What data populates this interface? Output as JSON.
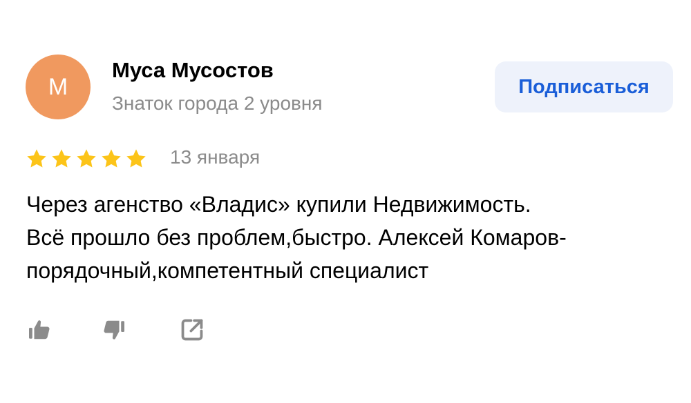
{
  "author": {
    "initial": "М",
    "name": "Муса Мусостов",
    "level": "Знаток города 2 уровня",
    "avatar_color": "#f0995f"
  },
  "subscribe": {
    "label": "Подписаться",
    "color": "#1a5ed8",
    "background": "#eef2fb"
  },
  "review": {
    "rating": 5,
    "rating_max": 5,
    "star_color": "#fcc419",
    "date": "13 января",
    "text_lines": [
      "Через агенство «Владис» купили Недвижимость.",
      "Всё прошло без проблем,быстро. Алексей Комаров-",
      "порядочный,компетентный специалист"
    ]
  },
  "actions": {
    "like_icon": "thumbs-up-icon",
    "dislike_icon": "thumbs-down-icon",
    "share_icon": "share-icon",
    "icon_color": "#8b8b8b"
  }
}
